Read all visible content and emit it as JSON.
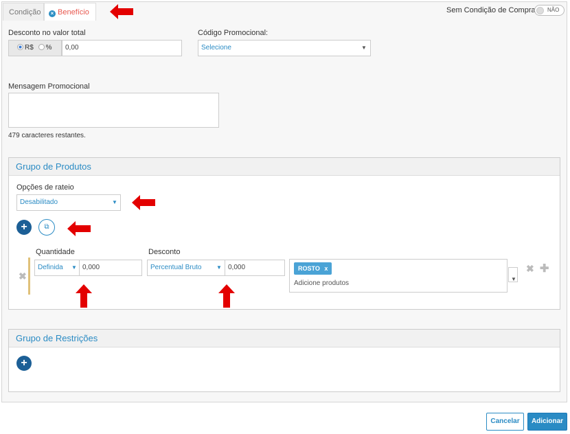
{
  "tabs": [
    {
      "label": "Condição"
    },
    {
      "label": "Benefício"
    }
  ],
  "toggle": {
    "label": "Sem Condição de Compra",
    "value": "NÃO"
  },
  "discount_total": {
    "label": "Desconto no valor total",
    "options": [
      "R$",
      "%"
    ],
    "selected": "R$",
    "value": "0,00"
  },
  "promo_code": {
    "label": "Código Promocional:",
    "selected": "Selecione"
  },
  "promo_message": {
    "label": "Mensagem Promocional",
    "value": "",
    "remaining": "479 caracteres restantes."
  },
  "product_group": {
    "title": "Grupo de Produtos",
    "rateio_label": "Opções de rateio",
    "rateio_selected": "Desabilitado",
    "row": {
      "qty_label": "Quantidade",
      "qty_type": "Definida",
      "qty_value": "0,000",
      "discount_label": "Desconto",
      "discount_type": "Percentual Bruto",
      "discount_value": "0,000",
      "tags": [
        "ROSTO"
      ],
      "tag_remove": "x",
      "products_placeholder": "Adicione produtos"
    }
  },
  "restrictions_group": {
    "title": "Grupo de Restrições"
  },
  "footer": {
    "cancel": "Cancelar",
    "add": "Adicionar"
  },
  "icons": {
    "add": "plus",
    "copy": "copy",
    "remove": "close",
    "annotation": "red-arrow"
  },
  "colors": {
    "accent": "#2a8bc4",
    "dark_accent": "#1c5f96",
    "tab_active_text": "#e8574e",
    "tag": "#4aa3d6",
    "annotation_arrow": "#e30000"
  }
}
